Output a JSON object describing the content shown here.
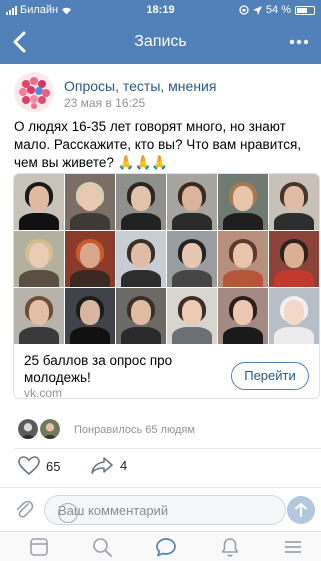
{
  "status": {
    "carrier": "Билайн",
    "time": "18:19",
    "battery": "54 %"
  },
  "nav": {
    "title": "Запись"
  },
  "post": {
    "group_name": "Опросы, тесты, мнения",
    "date": "23 мая в 16:25",
    "text": "О людях 16-35 лет говорят много, но знают мало. Расскажите, кто вы? Что вам нравится, чем вы живете? 🙏🙏🙏"
  },
  "ad": {
    "title": "25 баллов за опрос про молодежь!",
    "domain": "vk.com",
    "button_label": "Перейти",
    "photos": [
      {
        "bg": "#c9c2b8",
        "hair": "#1a1a1a",
        "face": "#e0b9a0",
        "body": "#111111"
      },
      {
        "bg": "#7a6e66",
        "hair": "#d9cdb0",
        "face": "#e9c8b2",
        "body": "#3e3a38"
      },
      {
        "bg": "#8f8f8c",
        "hair": "#2a2622",
        "face": "#e3c2aa",
        "body": "#222222"
      },
      {
        "bg": "#a7a49f",
        "hair": "#3a2b22",
        "face": "#dcb49b",
        "body": "#2b2b2b"
      },
      {
        "bg": "#6f7a72",
        "hair": "#a57a4e",
        "face": "#e7c4aa",
        "body": "#1f1f1f"
      },
      {
        "bg": "#c7c1ba",
        "hair": "#4a3628",
        "face": "#e1bca4",
        "body": "#2e2e2e"
      },
      {
        "bg": "#b2b09f",
        "hair": "#d5bd8f",
        "face": "#eacbb4",
        "body": "#5b4f44"
      },
      {
        "bg": "#8c3b2a",
        "hair": "#c85a2c",
        "face": "#d9a88c",
        "body": "#3a2a22"
      },
      {
        "bg": "#c8cdd3",
        "hair": "#3b3029",
        "face": "#dfbca6",
        "body": "#2d2d2d"
      },
      {
        "bg": "#9a9d9f",
        "hair": "#222222",
        "face": "#e6c6b0",
        "body": "#454545"
      },
      {
        "bg": "#b88f7c",
        "hair": "#5a3b2a",
        "face": "#e9c3aa",
        "body": "#b6553a"
      },
      {
        "bg": "#8b4238",
        "hair": "#2b211d",
        "face": "#dcae92",
        "body": "#c23a2e"
      },
      {
        "bg": "#b7b3ac",
        "hair": "#6b4e36",
        "face": "#e3bea6",
        "body": "#3a3a3a"
      },
      {
        "bg": "#40434a",
        "hair": "#1c1c1c",
        "face": "#d9b59f",
        "body": "#111111"
      },
      {
        "bg": "#6d6a66",
        "hair": "#3a2e28",
        "face": "#e0bba3",
        "body": "#2a2a2a"
      },
      {
        "bg": "#d8d4ce",
        "hair": "#3e2f26",
        "face": "#eccbb5",
        "body": "#6c6f73"
      },
      {
        "bg": "#a48a82",
        "hair": "#2c1f1a",
        "face": "#ebc7b2",
        "body": "#1a1a1a"
      },
      {
        "bg": "#b8bec6",
        "hair": "#f0f0f0",
        "face": "#f2d8c8",
        "body": "#ececec"
      }
    ]
  },
  "likes": {
    "text": "Понравилось 65 людям",
    "count": "65",
    "shares": "4"
  },
  "comment": {
    "placeholder": "Ваш комментарий"
  },
  "colors": {
    "accent": "#5181b8",
    "link": "#2a5885"
  },
  "icons": [
    "back-icon",
    "more-icon",
    "heart-icon",
    "share-icon",
    "paperclip-icon",
    "emoji-icon",
    "send-icon",
    "news-icon",
    "search-icon",
    "messages-icon",
    "notifications-icon",
    "menu-icon"
  ]
}
